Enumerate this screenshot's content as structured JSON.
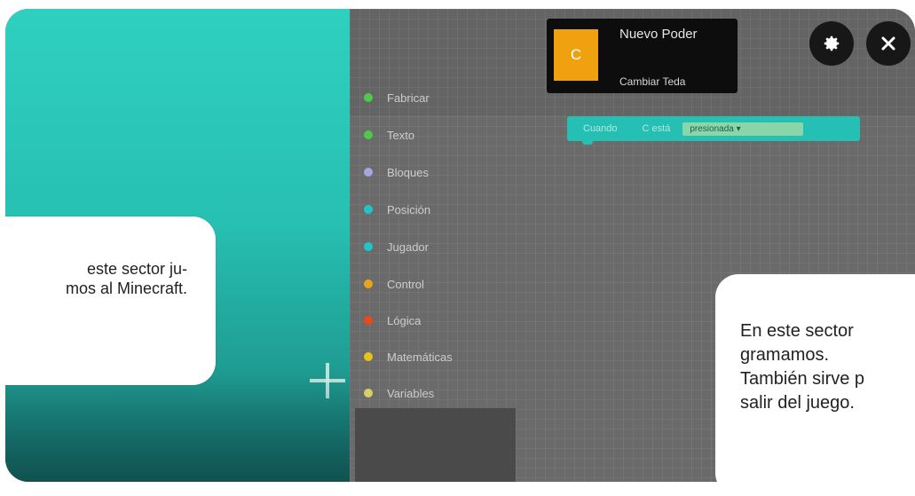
{
  "power_card": {
    "icon_letter": "C",
    "title": "Nuevo Poder",
    "subtitle": "Cambiar Teda"
  },
  "toolbar": {
    "settings_icon": "gear-icon",
    "close_icon": "close-icon"
  },
  "categories": [
    {
      "label": "Fabricar",
      "color": "#4ec94a"
    },
    {
      "label": "Texto",
      "color": "#4ec94a"
    },
    {
      "label": "Bloques",
      "color": "#a8a6e0"
    },
    {
      "label": "Posición",
      "color": "#22c5c5"
    },
    {
      "label": "Jugador",
      "color": "#22c5c5"
    },
    {
      "label": "Control",
      "color": "#e8a51a"
    },
    {
      "label": "Lógica",
      "color": "#e84a1c"
    },
    {
      "label": "Matemáticas",
      "color": "#e6c21a"
    },
    {
      "label": "Variables",
      "color": "#d7d06a"
    }
  ],
  "code_block": {
    "part1": "Cuando",
    "part2": "C  está",
    "dropdown_value": "presionada ▾"
  },
  "callouts": {
    "left_text": "este sector ju-\nmos al Minecraft.",
    "right_text": "En este sector\ngramamos.\nTambién sirve p\nsalir del juego."
  },
  "colors": {
    "accent_orange": "#f0a10f",
    "block_teal": "#26bfb3",
    "game_sky": "#2fd0c0"
  }
}
